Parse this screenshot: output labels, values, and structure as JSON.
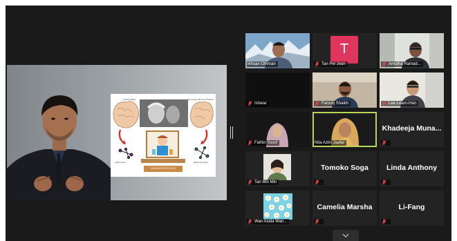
{
  "slide": {
    "label_healthy": "Healthy Brain",
    "label_dementia": "Dementia with Lewy Bodies",
    "label_left_mol": "Anthocyanin",
    "label_right_mol": "alpha-synuclein",
    "caption": "NEUROPROTECTION"
  },
  "participants": [
    {
      "name": "Ikhsan Othman",
      "kind": "video",
      "muted": false
    },
    {
      "name": "Tan Pei Jean",
      "kind": "avatar",
      "avatar_letter": "T",
      "muted": true
    },
    {
      "name": "Amutha Ramad...",
      "kind": "video",
      "muted": true
    },
    {
      "name": "Ishwar",
      "kind": "video",
      "muted": true
    },
    {
      "name": "Farooq Shaikh",
      "kind": "video",
      "muted": true
    },
    {
      "name": "Lee Learn-Han",
      "kind": "video",
      "muted": true
    },
    {
      "name": "Fathin Yusof",
      "kind": "video",
      "muted": true
    },
    {
      "name": "Nita Azlin Jaafar",
      "kind": "video",
      "muted": false,
      "active_speaker": true
    },
    {
      "name": "Khadeeja  Muna...",
      "kind": "name",
      "muted": true
    },
    {
      "name": "Tan Min Min",
      "kind": "photo",
      "muted": true
    },
    {
      "name": "Tomoko Soga",
      "kind": "name",
      "muted": true
    },
    {
      "name": "Linda Anthony",
      "kind": "name",
      "muted": true
    },
    {
      "name": "Wan Asida Wan...",
      "kind": "photo",
      "muted": true
    },
    {
      "name": "Camelia Marsha",
      "kind": "name",
      "muted": true
    },
    {
      "name": "Li-Fang",
      "kind": "name",
      "muted": true
    }
  ],
  "colors": {
    "active_border": "#b9d65a",
    "muted_icon": "#e0494b",
    "avatar_bg": "#e0355d"
  },
  "icons": {
    "muted": "mic-muted-icon",
    "scroll": "chevron-down-icon"
  }
}
